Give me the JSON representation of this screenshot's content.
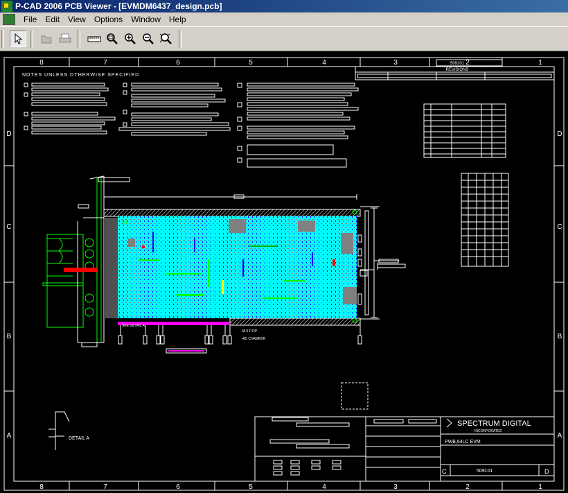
{
  "window": {
    "title": "P-CAD 2006 PCB Viewer - [EVMDM6437_design.pcb]"
  },
  "menu": [
    "File",
    "Edit",
    "View",
    "Options",
    "Window",
    "Help"
  ],
  "toolbar": {
    "tools": [
      "select-icon",
      "open-icon",
      "print-icon",
      "ruler-icon",
      "zoom-window-icon",
      "zoom-in-icon",
      "zoom-out-icon",
      "zoom-extents-icon"
    ]
  },
  "drawing": {
    "col_labels": [
      "8",
      "7",
      "6",
      "5",
      "4",
      "3",
      "2",
      "1"
    ],
    "row_labels": [
      "D",
      "C",
      "B",
      "A"
    ],
    "notes_heading": "NOTES UNLESS OTHERWISE SPECIFIED",
    "revisions_label": "REVISIONS",
    "revision_number": "509101",
    "detail_label": "DETAIL A",
    "company_name": "SPECTRUM DIGITAL",
    "company_sub": "INCORPORATED",
    "board_title": "PWB,64LC EVM",
    "doc_number": "509101",
    "size_letter": "C",
    "rev_letter": "D",
    "pcb_label_1": "SEE DETAIL A",
    "pcb_label_2": "Ø.3 P DP",
    "pcb_label_3": "4/5 CHAMFER"
  },
  "colors": {
    "canvas_bg": "#000000",
    "border": "#ffffff",
    "board_fill": "#00ffff",
    "silk_green": "#00ff00",
    "highlight_red": "#ff0000",
    "title_bar": "#0a246a"
  }
}
